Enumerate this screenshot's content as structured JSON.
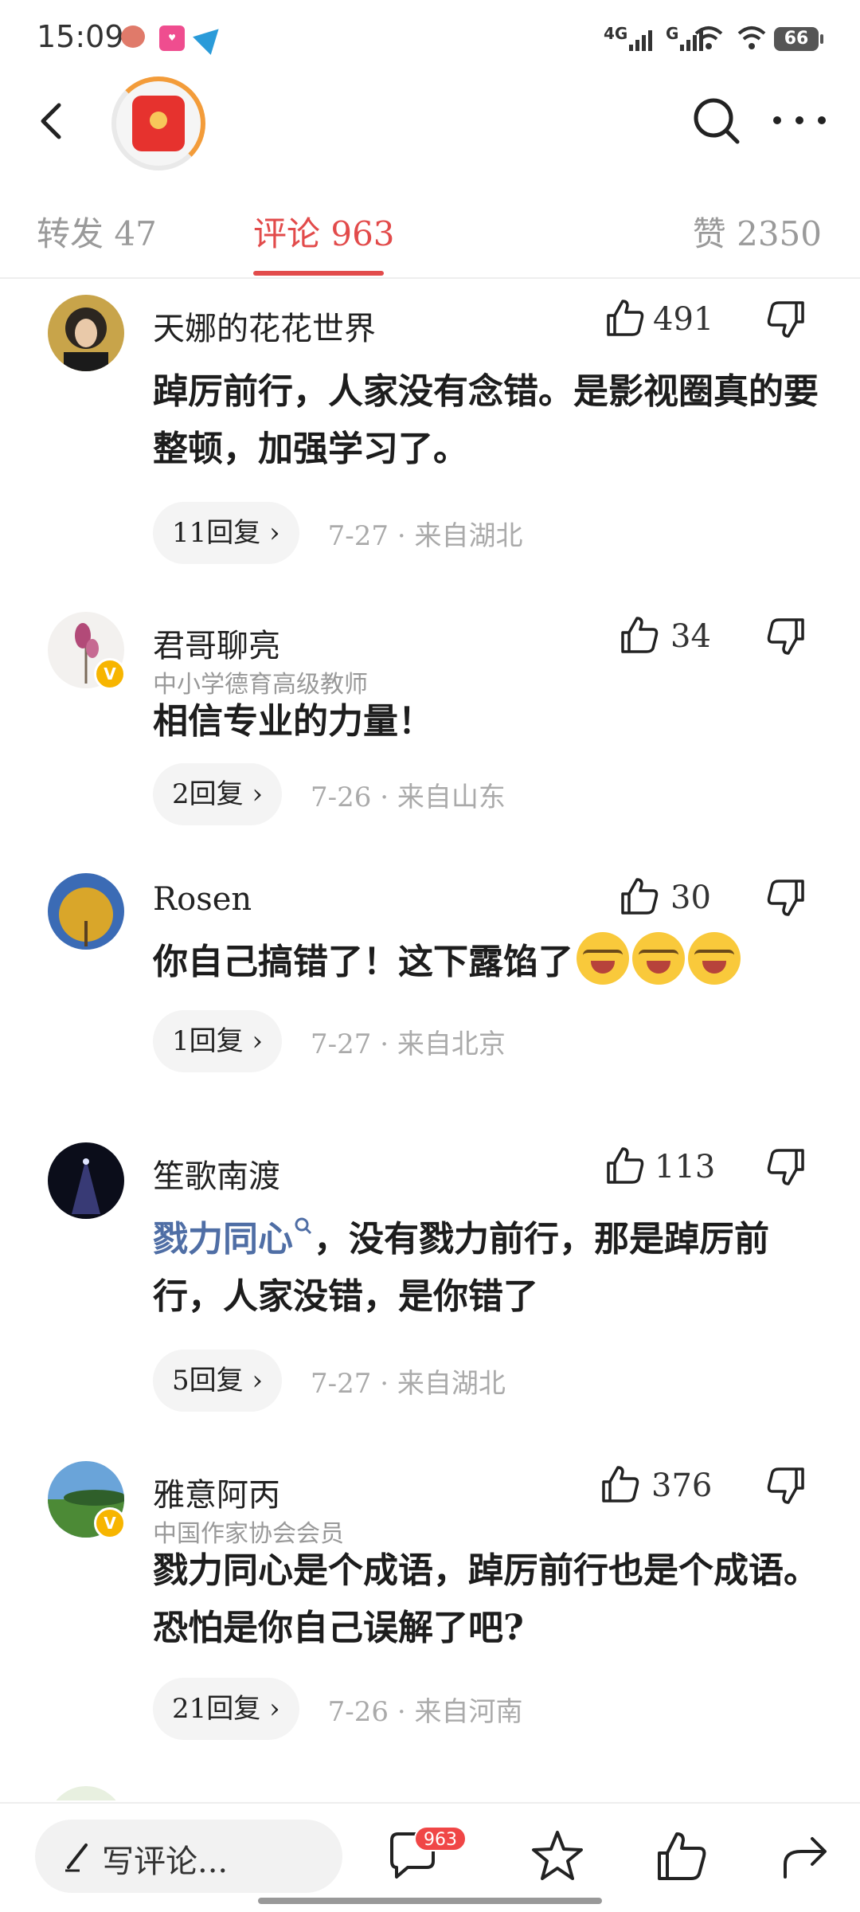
{
  "status_bar": {
    "time": "15:09",
    "battery": "66",
    "signal1": "4G",
    "signal2": "G"
  },
  "tabs": {
    "forward": "转发 47",
    "comments": "评论 963",
    "likes": "赞 2350"
  },
  "comments": [
    {
      "name": "天娜的花花世界",
      "title": "",
      "likes": "491",
      "text": "踔厉前行，人家没有念错。是影视圈真的要整顿，加强学习了。",
      "replies": "11回复",
      "date": "7-27",
      "location": "来自湖北",
      "verified": false
    },
    {
      "name": "君哥聊亮",
      "title": "中小学德育高级教师",
      "likes": "34",
      "text": "相信专业的力量！",
      "replies": "2回复",
      "date": "7-26",
      "location": "来自山东",
      "verified": true
    },
    {
      "name": "Rosen",
      "title": "",
      "likes": "30",
      "text": "你自己搞错了！这下露馅了",
      "replies": "1回复",
      "date": "7-27",
      "location": "来自北京",
      "verified": false
    },
    {
      "name": "笙歌南渡",
      "title": "",
      "likes": "113",
      "link": "戮力同心",
      "text": "，没有戮力前行，那是踔厉前行，人家没错，是你错了",
      "replies": "5回复",
      "date": "7-27",
      "location": "来自湖北",
      "verified": false
    },
    {
      "name": "雅意阿丙",
      "title": "中国作家协会会员",
      "likes": "376",
      "text": "戮力同心是个成语，踔厉前行也是个成语。恐怕是你自己误解了吧?",
      "replies": "21回复",
      "date": "7-26",
      "location": "来自河南",
      "verified": true
    }
  ],
  "bottom_bar": {
    "write_placeholder": "写评论...",
    "comment_badge": "963"
  },
  "colors": {
    "accent": "#e24b4b",
    "link": "#4f6ea5",
    "verified": "#f7b500"
  },
  "icons": [
    "back-arrow-icon",
    "search-icon",
    "more-icon",
    "thumbs-up-icon",
    "thumbs-down-icon",
    "pencil-icon",
    "comment-icon",
    "star-icon",
    "share-icon",
    "verified-icon"
  ]
}
